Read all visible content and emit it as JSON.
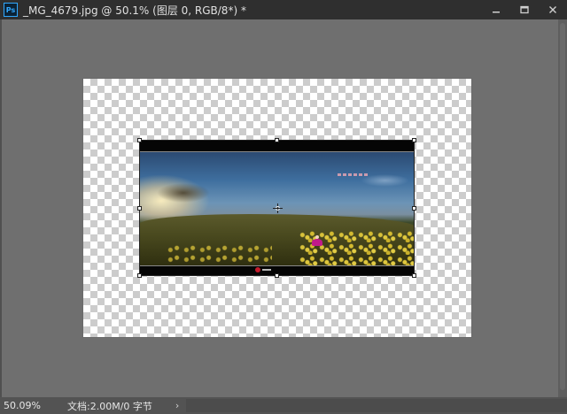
{
  "titlebar": {
    "app_icon_text": "Ps",
    "document_title": "_MG_4679.jpg @ 50.1% (图层 0, RGB/8*) *",
    "minimize_icon": "minimize-icon",
    "maximize_icon": "maximize-icon",
    "close_icon": "close-icon"
  },
  "statusbar": {
    "zoom": "50.09%",
    "doc_info": "文档:2.00M/0 字节",
    "arrow": "›"
  },
  "colors": {
    "titlebar_bg": "#2f2f2f",
    "workspace_bg": "#6f6f6f",
    "statusbar_bg": "#535353",
    "ps_accent": "#31a8ff"
  }
}
